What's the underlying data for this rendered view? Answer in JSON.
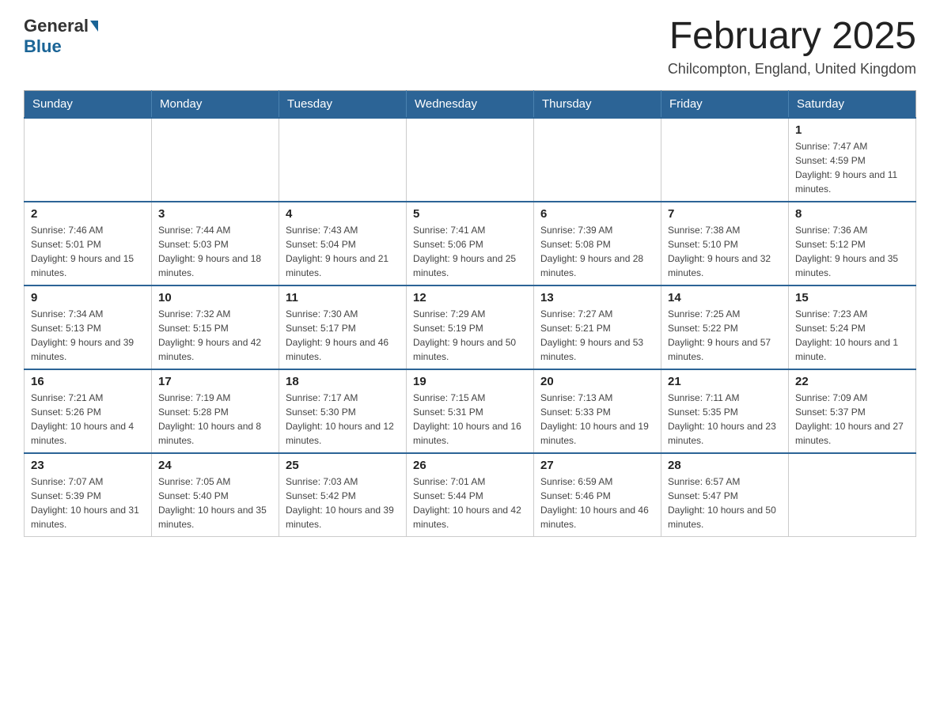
{
  "logo": {
    "general": "General",
    "blue": "Blue"
  },
  "header": {
    "title": "February 2025",
    "location": "Chilcompton, England, United Kingdom"
  },
  "days_of_week": [
    "Sunday",
    "Monday",
    "Tuesday",
    "Wednesday",
    "Thursday",
    "Friday",
    "Saturday"
  ],
  "weeks": [
    [
      {
        "day": "",
        "info": ""
      },
      {
        "day": "",
        "info": ""
      },
      {
        "day": "",
        "info": ""
      },
      {
        "day": "",
        "info": ""
      },
      {
        "day": "",
        "info": ""
      },
      {
        "day": "",
        "info": ""
      },
      {
        "day": "1",
        "info": "Sunrise: 7:47 AM\nSunset: 4:59 PM\nDaylight: 9 hours and 11 minutes."
      }
    ],
    [
      {
        "day": "2",
        "info": "Sunrise: 7:46 AM\nSunset: 5:01 PM\nDaylight: 9 hours and 15 minutes."
      },
      {
        "day": "3",
        "info": "Sunrise: 7:44 AM\nSunset: 5:03 PM\nDaylight: 9 hours and 18 minutes."
      },
      {
        "day": "4",
        "info": "Sunrise: 7:43 AM\nSunset: 5:04 PM\nDaylight: 9 hours and 21 minutes."
      },
      {
        "day": "5",
        "info": "Sunrise: 7:41 AM\nSunset: 5:06 PM\nDaylight: 9 hours and 25 minutes."
      },
      {
        "day": "6",
        "info": "Sunrise: 7:39 AM\nSunset: 5:08 PM\nDaylight: 9 hours and 28 minutes."
      },
      {
        "day": "7",
        "info": "Sunrise: 7:38 AM\nSunset: 5:10 PM\nDaylight: 9 hours and 32 minutes."
      },
      {
        "day": "8",
        "info": "Sunrise: 7:36 AM\nSunset: 5:12 PM\nDaylight: 9 hours and 35 minutes."
      }
    ],
    [
      {
        "day": "9",
        "info": "Sunrise: 7:34 AM\nSunset: 5:13 PM\nDaylight: 9 hours and 39 minutes."
      },
      {
        "day": "10",
        "info": "Sunrise: 7:32 AM\nSunset: 5:15 PM\nDaylight: 9 hours and 42 minutes."
      },
      {
        "day": "11",
        "info": "Sunrise: 7:30 AM\nSunset: 5:17 PM\nDaylight: 9 hours and 46 minutes."
      },
      {
        "day": "12",
        "info": "Sunrise: 7:29 AM\nSunset: 5:19 PM\nDaylight: 9 hours and 50 minutes."
      },
      {
        "day": "13",
        "info": "Sunrise: 7:27 AM\nSunset: 5:21 PM\nDaylight: 9 hours and 53 minutes."
      },
      {
        "day": "14",
        "info": "Sunrise: 7:25 AM\nSunset: 5:22 PM\nDaylight: 9 hours and 57 minutes."
      },
      {
        "day": "15",
        "info": "Sunrise: 7:23 AM\nSunset: 5:24 PM\nDaylight: 10 hours and 1 minute."
      }
    ],
    [
      {
        "day": "16",
        "info": "Sunrise: 7:21 AM\nSunset: 5:26 PM\nDaylight: 10 hours and 4 minutes."
      },
      {
        "day": "17",
        "info": "Sunrise: 7:19 AM\nSunset: 5:28 PM\nDaylight: 10 hours and 8 minutes."
      },
      {
        "day": "18",
        "info": "Sunrise: 7:17 AM\nSunset: 5:30 PM\nDaylight: 10 hours and 12 minutes."
      },
      {
        "day": "19",
        "info": "Sunrise: 7:15 AM\nSunset: 5:31 PM\nDaylight: 10 hours and 16 minutes."
      },
      {
        "day": "20",
        "info": "Sunrise: 7:13 AM\nSunset: 5:33 PM\nDaylight: 10 hours and 19 minutes."
      },
      {
        "day": "21",
        "info": "Sunrise: 7:11 AM\nSunset: 5:35 PM\nDaylight: 10 hours and 23 minutes."
      },
      {
        "day": "22",
        "info": "Sunrise: 7:09 AM\nSunset: 5:37 PM\nDaylight: 10 hours and 27 minutes."
      }
    ],
    [
      {
        "day": "23",
        "info": "Sunrise: 7:07 AM\nSunset: 5:39 PM\nDaylight: 10 hours and 31 minutes."
      },
      {
        "day": "24",
        "info": "Sunrise: 7:05 AM\nSunset: 5:40 PM\nDaylight: 10 hours and 35 minutes."
      },
      {
        "day": "25",
        "info": "Sunrise: 7:03 AM\nSunset: 5:42 PM\nDaylight: 10 hours and 39 minutes."
      },
      {
        "day": "26",
        "info": "Sunrise: 7:01 AM\nSunset: 5:44 PM\nDaylight: 10 hours and 42 minutes."
      },
      {
        "day": "27",
        "info": "Sunrise: 6:59 AM\nSunset: 5:46 PM\nDaylight: 10 hours and 46 minutes."
      },
      {
        "day": "28",
        "info": "Sunrise: 6:57 AM\nSunset: 5:47 PM\nDaylight: 10 hours and 50 minutes."
      },
      {
        "day": "",
        "info": ""
      }
    ]
  ]
}
